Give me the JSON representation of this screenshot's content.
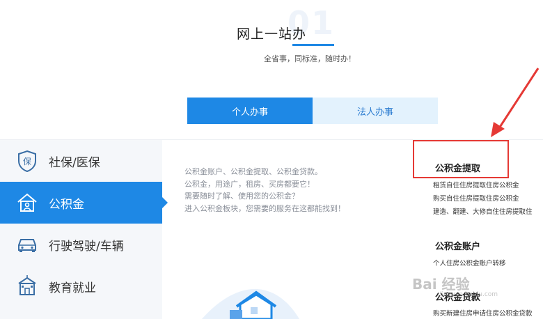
{
  "header": {
    "bg_number": "01",
    "title": "网上一站办",
    "subtitle": "全省事，同标准，随时办！"
  },
  "tabs": [
    {
      "label": "个人办事",
      "active": true
    },
    {
      "label": "法人办事",
      "active": false
    }
  ],
  "sidebar": {
    "items": [
      {
        "label": "社保/医保",
        "icon": "shield-insurance-icon",
        "active": false
      },
      {
        "label": "公积金",
        "icon": "house-fund-icon",
        "active": true
      },
      {
        "label": "行驶驾驶/车辆",
        "icon": "car-icon",
        "active": false
      },
      {
        "label": "教育就业",
        "icon": "school-building-icon",
        "active": false
      }
    ]
  },
  "description": {
    "lines": [
      "公积金账户、公积金提取、公积金贷款。",
      "公积金，用途广，租房、买房都要它！",
      "需要随时了解、使用您的公积金？",
      "进入公积金板块，您需要的服务在这都能找到！"
    ]
  },
  "services": [
    {
      "title": "公积金提取",
      "items": [
        "租赁自住住房提取住房公积金",
        "购买自住住房提取住房公积金",
        "建造、翻建、大修自住住房提取住"
      ]
    },
    {
      "title": "公积金账户",
      "items": [
        "个人住房公积金账户转移"
      ]
    },
    {
      "title": "公积金贷款",
      "items": [
        "购买新建住房申请住房公积金贷款"
      ]
    }
  ],
  "watermark": {
    "text": "Bai 经验",
    "sub": "jingyan.baidu.com"
  },
  "colors": {
    "accent": "#1e88e5",
    "highlight": "#e53935"
  }
}
